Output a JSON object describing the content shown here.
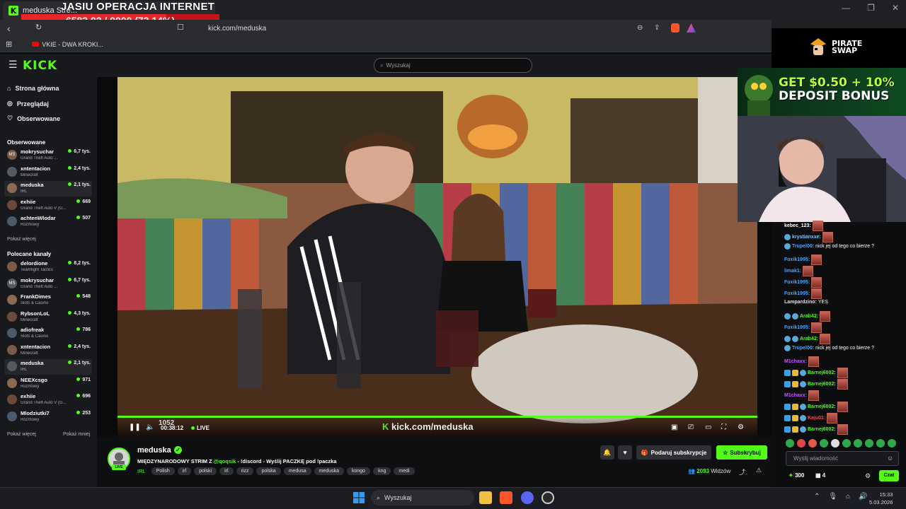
{
  "browser": {
    "tab_title": "meduska Stre...",
    "url": "kick.com/meduska",
    "bookmark": "VKIE - DWA KROKI...",
    "window_controls": [
      "—",
      "❐",
      "✕"
    ]
  },
  "overlay": {
    "title": "JASIU OPERACJA INTERNET",
    "counter": "6583.02 / 9000 (73.14%)",
    "progress": 0.7314,
    "colors": {
      "bar": "#c4141a",
      "fill": "#e8252b"
    }
  },
  "kick": {
    "logo": "KICK",
    "search_placeholder": "Wyszukaj",
    "nav": {
      "home": "Strona główna",
      "browse": "Przeglądaj",
      "following": "Obserwowane"
    },
    "followed_heading": "Obserwowane",
    "followed": [
      {
        "name": "mokrysuchar",
        "category": "Grand Theft Auto ...",
        "viewers": "6,7 tys.",
        "avatar": "MS"
      },
      {
        "name": "xntentacion",
        "category": "Minecraft",
        "viewers": "2,4 tys.",
        "avatar": ""
      },
      {
        "name": "meduska",
        "category": "IRL",
        "viewers": "2,1 tys.",
        "avatar": ""
      },
      {
        "name": "exhiie",
        "category": "Grand Theft Auto V (G...",
        "viewers": "669",
        "avatar": ""
      },
      {
        "name": "achtenWlodar",
        "category": "Rozmowy",
        "viewers": "507",
        "avatar": ""
      }
    ],
    "show_more_1": "Pokaż więcej",
    "recommended_heading": "Polecane kanały",
    "recommended": [
      {
        "name": "delordione",
        "category": "Teamfight Tactics",
        "viewers": "8,2 tys.",
        "avatar": ""
      },
      {
        "name": "mokrysuchar",
        "category": "Grand Theft Auto ...",
        "viewers": "6,7 tys.",
        "avatar": "MS"
      },
      {
        "name": "FrankDimes",
        "category": "Slots & Casino",
        "viewers": "548",
        "avatar": ""
      },
      {
        "name": "RybsonLoL",
        "category": "Minecraft",
        "viewers": "4,3 tys.",
        "avatar": ""
      },
      {
        "name": "adiofreak",
        "category": "Slots & Casino",
        "viewers": "786",
        "avatar": ""
      },
      {
        "name": "xntentacion",
        "category": "Minecraft",
        "viewers": "2,4 tys.",
        "avatar": ""
      },
      {
        "name": "meduska",
        "category": "IRL",
        "viewers": "2,1 tys.",
        "avatar": ""
      },
      {
        "name": "NEEXcsgo",
        "category": "Rozmowy",
        "viewers": "971",
        "avatar": ""
      },
      {
        "name": "exhiie",
        "category": "Grand Theft Auto V (G...",
        "viewers": "696",
        "avatar": ""
      },
      {
        "name": "Mlodziutki7",
        "category": "Rozmowy",
        "viewers": "253",
        "avatar": ""
      }
    ],
    "show_more_2": "Pokaż więcej",
    "show_less": "Pokaż mniej"
  },
  "player": {
    "time": "00:38:12",
    "live_label": "LIVE",
    "watermark": "kick.com/meduska",
    "overlay_number": "1052"
  },
  "stream": {
    "streamer": "meduska",
    "live_badge": "LIVE",
    "title_prefix": "MIĘDZYNARODOWY STRIM Z ",
    "title_mention": "@qoqsik",
    "title_suffix": " - !discord - Wyślij PACZKĘ pod !paczka",
    "category": "IRL",
    "tags": [
      "Polish",
      "irl",
      "polski",
      "irl",
      "rizz",
      "polska",
      "medusa",
      "meduska",
      "kongo",
      "kng",
      "medi"
    ],
    "viewers_count": "2093",
    "viewers_label": "Widzów",
    "gift_label": "Podaruj subskrypcje",
    "subscribe_label": "Subskrybuj"
  },
  "ads": {
    "pirate_swap": "PIRATE SWAP",
    "banner_line1": "GET $0.50 + 10%",
    "banner_line2": "DEPOSIT BONUS"
  },
  "chat": {
    "messages": [
      {
        "user": "kebec_123:",
        "color": "#ffffff",
        "text": "",
        "emote": true,
        "badges": []
      },
      {
        "user": "krystianxxe:",
        "color": "#7ec8ff",
        "text": "",
        "emote": true,
        "badges": [
          "b3"
        ]
      },
      {
        "user": "Trupel00:",
        "color": "#4aa3ff",
        "text": "nick jej od tego co bierze ?",
        "emote": false,
        "badges": [
          "b3"
        ]
      },
      {
        "user": "Foxik1995:",
        "color": "#4aa3ff",
        "text": "",
        "emote": true,
        "badges": []
      },
      {
        "user": "limak1:",
        "color": "#4aa3ff",
        "text": "",
        "emote": true,
        "badges": []
      },
      {
        "user": "Foxik1995:",
        "color": "#4aa3ff",
        "text": "",
        "emote": true,
        "badges": []
      },
      {
        "user": "Foxik1995:",
        "color": "#4aa3ff",
        "text": "",
        "emote": true,
        "badges": []
      },
      {
        "user": "Lampardzino:",
        "color": "#e0e0e0",
        "text": "YES",
        "emote": false,
        "badges": []
      },
      {
        "user": "Arab42:",
        "color": "#53fc18",
        "text": "",
        "emote": true,
        "badges": [
          "b3",
          "b3"
        ]
      },
      {
        "user": "Foxik1995:",
        "color": "#4aa3ff",
        "text": "",
        "emote": true,
        "badges": []
      },
      {
        "user": "Arab42:",
        "color": "#53fc18",
        "text": "",
        "emote": true,
        "badges": [
          "b3",
          "b3"
        ]
      },
      {
        "user": "Trupel00:",
        "color": "#4aa3ff",
        "text": "nick jej od tego co bierze ?",
        "emote": false,
        "badges": [
          "b3"
        ]
      },
      {
        "user": "M1chaxx:",
        "color": "#c45cff",
        "text": "",
        "emote": true,
        "badges": []
      },
      {
        "user": "Barnej6002:",
        "color": "#53fc18",
        "text": "",
        "emote": true,
        "badges": [
          "b1",
          "b2",
          "b3"
        ]
      },
      {
        "user": "Barnej6002:",
        "color": "#53fc18",
        "text": "",
        "emote": true,
        "badges": [
          "b1",
          "b2",
          "b3"
        ]
      },
      {
        "user": "M1chaxx:",
        "color": "#c45cff",
        "text": "",
        "emote": true,
        "badges": []
      },
      {
        "user": "Barnej6002:",
        "color": "#53fc18",
        "text": "",
        "emote": true,
        "badges": [
          "b1",
          "b2",
          "b3"
        ]
      },
      {
        "user": "Kaju01:",
        "color": "#ff4a4a",
        "text": "",
        "emote": true,
        "badges": [
          "b1",
          "b2",
          "b3"
        ]
      },
      {
        "user": "Barnej6002:",
        "color": "#53fc18",
        "text": "",
        "emote": true,
        "badges": [
          "b1",
          "b2",
          "b3"
        ]
      }
    ],
    "input_placeholder": "Wyślij wiadomość",
    "points": "300",
    "bag": "4",
    "send_label": "Czat"
  },
  "taskbar": {
    "search_placeholder": "Wyszukaj",
    "time": "15:33",
    "date": "5.03.2026"
  }
}
